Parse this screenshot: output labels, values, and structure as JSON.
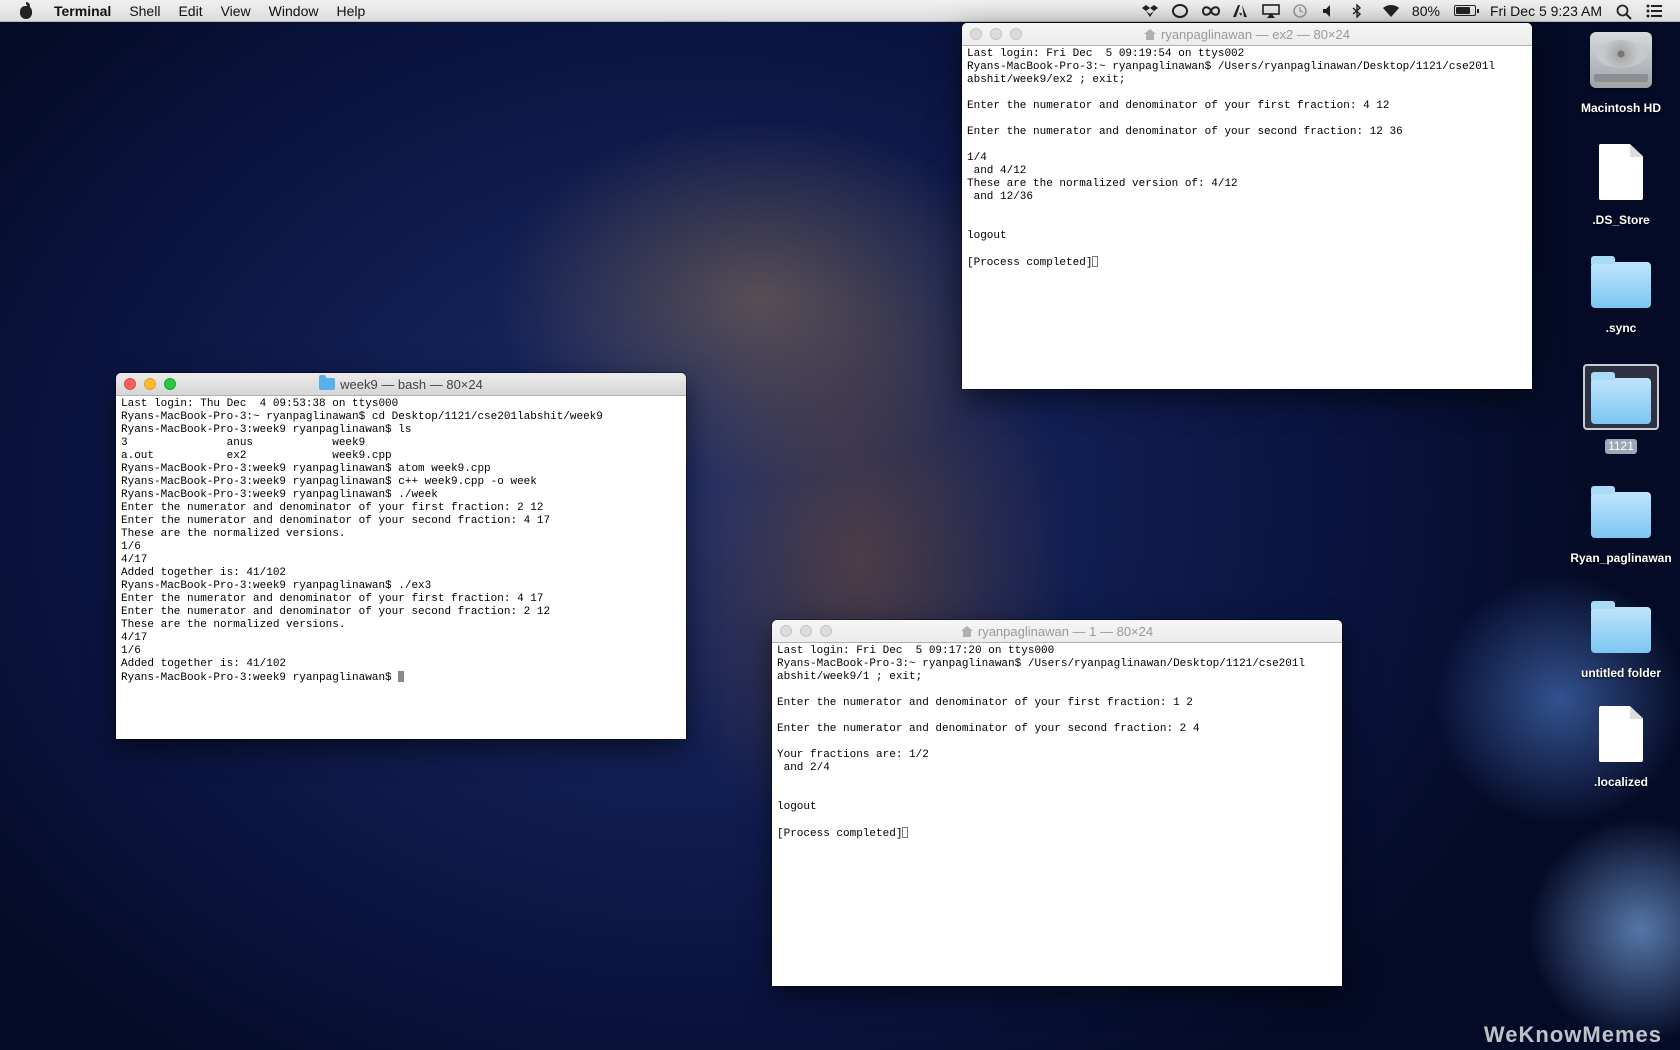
{
  "menubar": {
    "app_name": "Terminal",
    "menus": [
      "Shell",
      "Edit",
      "View",
      "Window",
      "Help"
    ],
    "battery_percent": "80%",
    "battery_level": 0.8,
    "clock": "Fri Dec 5  9:23 AM",
    "status_icons": [
      "dropbox-icon",
      "app-icon",
      "creative-cloud-icon",
      "adobe-icon",
      "airplay-icon",
      "time-machine-icon",
      "volume-icon",
      "bluetooth-icon",
      "wifi-icon"
    ]
  },
  "windows": {
    "week9": {
      "title": "week9 — bash — 80×24",
      "content": "Last login: Thu Dec  4 09:53:38 on ttys000\nRyans-MacBook-Pro-3:~ ryanpaglinawan$ cd Desktop/1121/cse201labshit/week9\nRyans-MacBook-Pro-3:week9 ryanpaglinawan$ ls\n3               anus            week9\na.out           ex2             week9.cpp\nRyans-MacBook-Pro-3:week9 ryanpaglinawan$ atom week9.cpp\nRyans-MacBook-Pro-3:week9 ryanpaglinawan$ c++ week9.cpp -o week\nRyans-MacBook-Pro-3:week9 ryanpaglinawan$ ./week\nEnter the numerator and denominator of your first fraction: 2 12\nEnter the numerator and denominator of your second fraction: 4 17\nThese are the normalized versions.\n1/6\n4/17\nAdded together is: 41/102\nRyans-MacBook-Pro-3:week9 ryanpaglinawan$ ./ex3\nEnter the numerator and denominator of your first fraction: 4 17\nEnter the numerator and denominator of your second fraction: 2 12\nThese are the normalized versions.\n4/17\n1/6\nAdded together is: 41/102\nRyans-MacBook-Pro-3:week9 ryanpaglinawan$ "
    },
    "ex2": {
      "title": "ryanpaglinawan — ex2 — 80×24",
      "content": "Last login: Fri Dec  5 09:19:54 on ttys002\nRyans-MacBook-Pro-3:~ ryanpaglinawan$ /Users/ryanpaglinawan/Desktop/1121/cse201l\nabshit/week9/ex2 ; exit;\n\nEnter the numerator and denominator of your first fraction: 4 12\n\nEnter the numerator and denominator of your second fraction: 12 36\n\n1/4\n and 4/12\nThese are the normalized version of: 4/12\n and 12/36\n\n\nlogout\n\n[Process completed]"
    },
    "one": {
      "title": "ryanpaglinawan — 1 — 80×24",
      "content": "Last login: Fri Dec  5 09:17:20 on ttys000\nRyans-MacBook-Pro-3:~ ryanpaglinawan$ /Users/ryanpaglinawan/Desktop/1121/cse201l\nabshit/week9/1 ; exit;\n\nEnter the numerator and denominator of your first fraction: 1 2\n\nEnter the numerator and denominator of your second fraction: 2 4\n\nYour fractions are: 1/2\n and 2/4\n\n\nlogout\n\n[Process completed]"
    }
  },
  "desktop_icons": [
    {
      "label": "Macintosh HD",
      "icon": "hard-drive-icon"
    },
    {
      "label": ".DS_Store",
      "icon": "document-icon"
    },
    {
      "label": ".sync",
      "icon": "folder-icon"
    },
    {
      "label": "1121",
      "icon": "folder-icon"
    },
    {
      "label": "Ryan_paglinawan",
      "icon": "folder-icon"
    },
    {
      "label": "untitled folder",
      "icon": "folder-icon"
    },
    {
      "label": ".localized",
      "icon": "document-icon"
    }
  ],
  "watermark": "WeKnowMemes"
}
